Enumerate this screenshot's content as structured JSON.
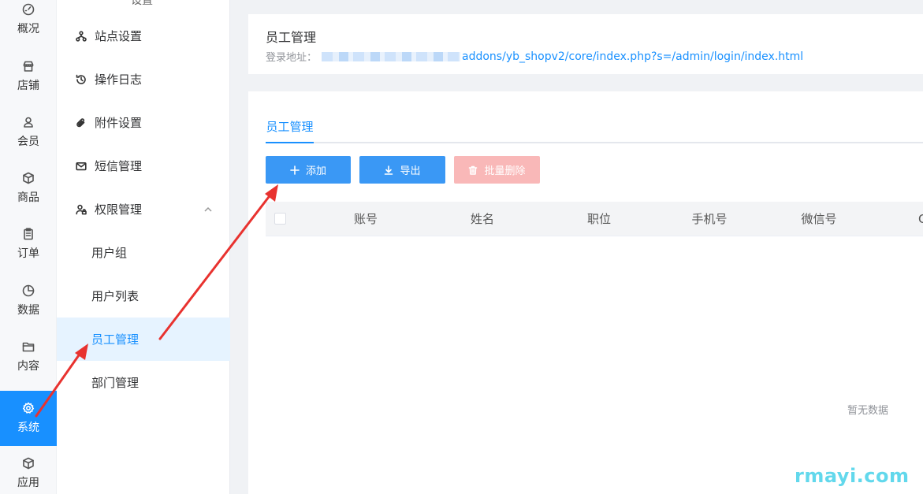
{
  "rail": {
    "items": [
      {
        "label": "概况",
        "icon": "dashboard-icon"
      },
      {
        "label": "店铺",
        "icon": "store-icon"
      },
      {
        "label": "会员",
        "icon": "user-icon"
      },
      {
        "label": "商品",
        "icon": "box-icon"
      },
      {
        "label": "订单",
        "icon": "clipboard-icon"
      },
      {
        "label": "数据",
        "icon": "pie-chart-icon"
      },
      {
        "label": "内容",
        "icon": "folder-icon"
      },
      {
        "label": "系统",
        "icon": "gear-icon",
        "active": true
      },
      {
        "label": "应用",
        "icon": "cube-icon"
      }
    ]
  },
  "submenu": {
    "partial_top_label": "设置",
    "items": [
      {
        "label": "站点设置",
        "icon": "sitemap-icon"
      },
      {
        "label": "操作日志",
        "icon": "history-icon"
      },
      {
        "label": "附件设置",
        "icon": "paperclip-icon"
      },
      {
        "label": "短信管理",
        "icon": "mail-icon"
      },
      {
        "label": "权限管理",
        "icon": "user-lock-icon",
        "expanded": true
      }
    ],
    "children": [
      {
        "label": "用户组"
      },
      {
        "label": "用户列表"
      },
      {
        "label": "员工管理",
        "active": true
      },
      {
        "label": "部门管理"
      }
    ]
  },
  "header": {
    "title": "员工管理",
    "login_label": "登录地址：",
    "login_url": "addons/yb_shopv2/core/index.php?s=/admin/login/index.html"
  },
  "tabs": [
    {
      "label": "员工管理",
      "active": true
    }
  ],
  "toolbar": {
    "add_label": "添加",
    "export_label": "导出",
    "batch_delete_label": "批量删除"
  },
  "table": {
    "columns": [
      "账号",
      "姓名",
      "职位",
      "手机号",
      "微信号",
      "C"
    ],
    "empty_text": "暂无数据"
  },
  "watermark": "rmayi.com",
  "colors": {
    "primary": "#1890ff",
    "button_primary": "#3a98f5",
    "button_danger_disabled": "#f9b8b8",
    "active_bg": "#e6f3ff",
    "arrow": "#e8322f"
  }
}
